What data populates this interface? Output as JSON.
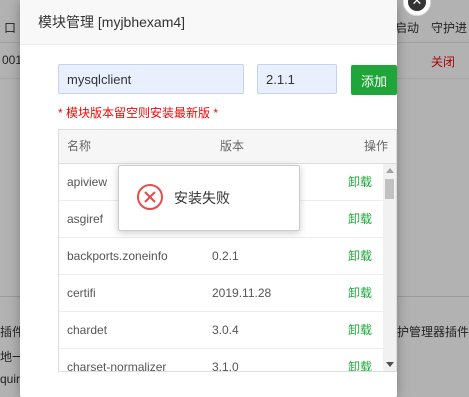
{
  "background": {
    "header_left": "口",
    "header_col_a": "启动",
    "header_col_b": "守护进",
    "row_left": "001",
    "row_status": "关闭",
    "footer_line1_left": "插件",
    "footer_line1_right": "护管理器插件会",
    "footer_line2_left": "地一",
    "footer_line3_left": "quir"
  },
  "dialog": {
    "title": "模块管理 [myjbhexam4]",
    "module_name_value": "mysqlclient",
    "version_value": "2.1.1",
    "add_label": "添加",
    "tip": "* 模块版本留空则安装最新版 *",
    "table": {
      "headers": {
        "name": "名称",
        "version": "版本",
        "action": "操作"
      },
      "rows": [
        {
          "name": "apiview",
          "version": "",
          "action": "卸载"
        },
        {
          "name": "asgiref",
          "version": "",
          "action": "卸载"
        },
        {
          "name": "backports.zoneinfo",
          "version": "0.2.1",
          "action": "卸载"
        },
        {
          "name": "certifi",
          "version": "2019.11.28",
          "action": "卸载"
        },
        {
          "name": "chardet",
          "version": "3.0.4",
          "action": "卸载"
        },
        {
          "name": "charset-normalizer",
          "version": "3.1.0",
          "action": "卸载"
        }
      ]
    }
  },
  "toast": {
    "message": "安装失败",
    "icon": "error-circle-icon",
    "icon_color": "#e84b4b"
  },
  "colors": {
    "accent": "#20a53a",
    "warning": "#ef0808"
  }
}
